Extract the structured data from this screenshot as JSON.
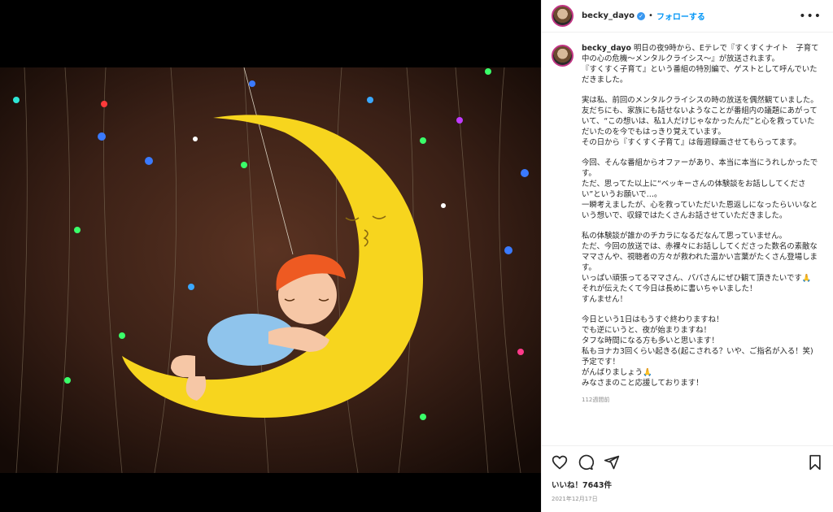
{
  "post": {
    "username": "becky_dayo",
    "follow_label": "フォローする",
    "separator": "•",
    "more_label": "•••",
    "verified_mark": "✓"
  },
  "caption": {
    "username": "becky_dayo",
    "lines": [
      "明日の夜9時から、Eテレで『すくすくナイト　子育て中の心の危機〜メンタルクライシス〜』が放送されます。",
      "『すくすく子育て』という番組の特別編で、ゲストとして呼んでいただきました。",
      "",
      "実は私、前回のメンタルクライシスの時の放送を偶然観ていました。",
      "友だちにも、家族にも話せないようなことが番組内の議題にあがっていて、“この想いは、私1人だけじゃなかったんだ”と心を救っていただいたのを今でもはっきり覚えています。",
      "その日から『すくすく子育て』は毎週録画させてもらってます。",
      "",
      "今回、そんな番組からオファーがあり、本当に本当にうれしかったです。",
      "ただ、思ってた以上に“ベッキーさんの体験談をお話ししてください”というお願いで…。",
      "一瞬考えましたが、心を救っていただいた恩返しになったらいいなという想いで、収録ではたくさんお話させていただきました。",
      "",
      "私の体験談が誰かのチカラになるだなんて思っていません。",
      "ただ、今回の放送では、赤裸々にお話ししてくださった数名の素敵なママさんや、視聴者の方々が救われた温かい言葉がたくさん登場します。",
      "いっぱい頑張ってるママさん、パパさんにぜひ観て頂きたいです🙏",
      "それが伝えたくて今日は長めに書いちゃいました！",
      "すんません！",
      "",
      "今日という1日はもうすぐ終わりますね！",
      "でも逆にいうと、夜が始まりますね！",
      "タフな時間になる方も多いと思います！",
      "私もヨナカ3回くらい起きる(起こされる？いや、ご指名が入る！笑)",
      "予定です！",
      "がんばりましょう🙏",
      "みなさまのこと応援しております！"
    ],
    "time": "112週間前"
  },
  "actions": {
    "like_icon": "heart-icon",
    "comment_icon": "comment-icon",
    "share_icon": "share-icon",
    "save_icon": "bookmark-icon"
  },
  "likes_text": "いいね！7643件",
  "date_text": "2021年12月17日",
  "colors": {
    "moon": "#f7d51e",
    "background": "#2b1710",
    "link": "#0095f6",
    "hair": "#ee5a22",
    "pajama": "#8fc4ec"
  }
}
